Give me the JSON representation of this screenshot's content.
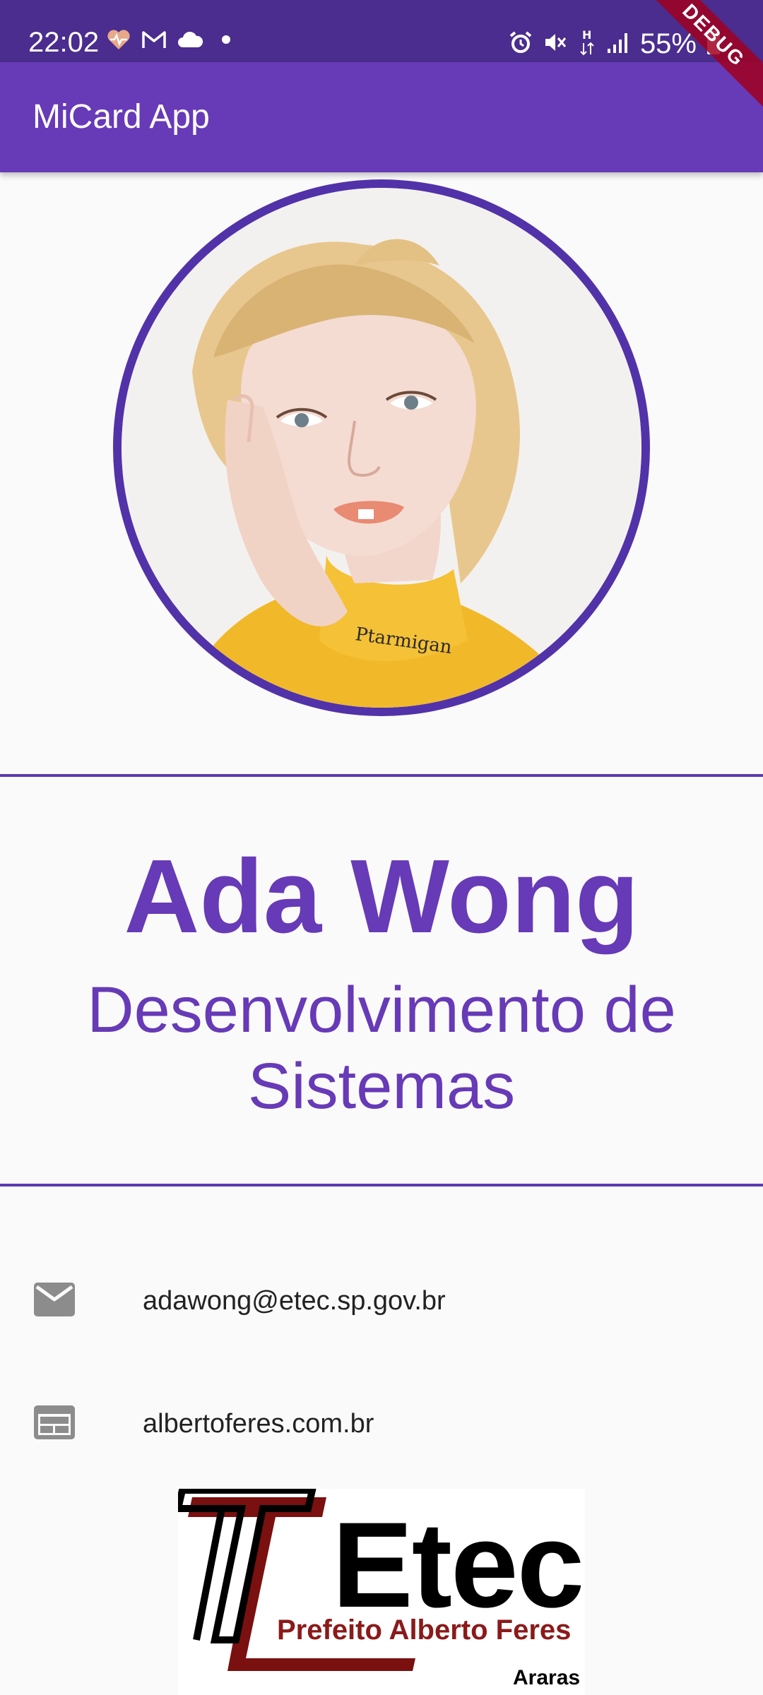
{
  "status_bar": {
    "time": "22:02",
    "battery": "55%",
    "icons_left": [
      "heart-monitor-icon",
      "gmail-icon",
      "cloud-icon",
      "dot-icon"
    ],
    "icons_right": [
      "alarm-icon",
      "mute-icon",
      "data-h-icon",
      "signal-icon",
      "battery-icon"
    ]
  },
  "app_bar": {
    "title": "MiCard App",
    "color": "#673ab7"
  },
  "debug_banner": "DEBUG",
  "profile": {
    "name": "Ada Wong",
    "role": "Desenvolvimento de Sistemas"
  },
  "contacts": [
    {
      "icon": "email-icon",
      "text": "adawong@etec.sp.gov.br"
    },
    {
      "icon": "web-icon",
      "text": "albertoferes.com.br"
    }
  ],
  "logo": {
    "title": "Etec",
    "subtitle": "Prefeito Alberto Feres",
    "city": "Araras"
  },
  "colors": {
    "primary": "#673ab7",
    "status_bar": "#4a2d8e",
    "divider": "#5c3bb0",
    "background": "#fafafa"
  }
}
